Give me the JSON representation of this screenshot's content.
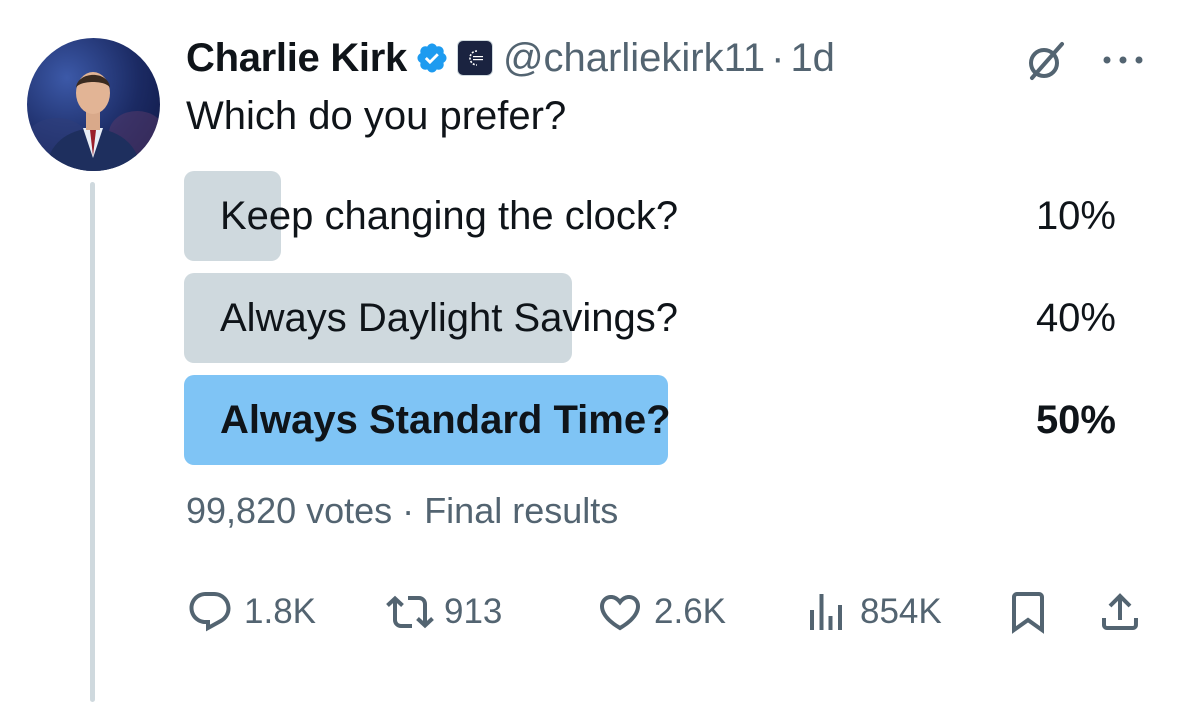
{
  "author": {
    "name": "Charlie Kirk",
    "handle": "@charliekirk11",
    "separator": "·",
    "time": "1d"
  },
  "tweet": {
    "text": "Which do you prefer?"
  },
  "poll": {
    "options": [
      {
        "label": "Keep changing the clock?",
        "percent_text": "10%",
        "percent": 10,
        "winner": false
      },
      {
        "label": "Always Daylight Savings?",
        "percent_text": "40%",
        "percent": 40,
        "winner": false
      },
      {
        "label": "Always Standard Time?",
        "percent_text": "50%",
        "percent": 50,
        "winner": true
      }
    ],
    "votes": "99,820 votes",
    "separator": "·",
    "status": "Final results"
  },
  "actions": {
    "replies": "1.8K",
    "reposts": "913",
    "likes": "2.6K",
    "views": "854K"
  },
  "colors": {
    "verified": "#1d9bf0",
    "bar_default": "#cfd9de",
    "bar_winner": "#7fc4f5",
    "text_secondary": "#536471"
  }
}
